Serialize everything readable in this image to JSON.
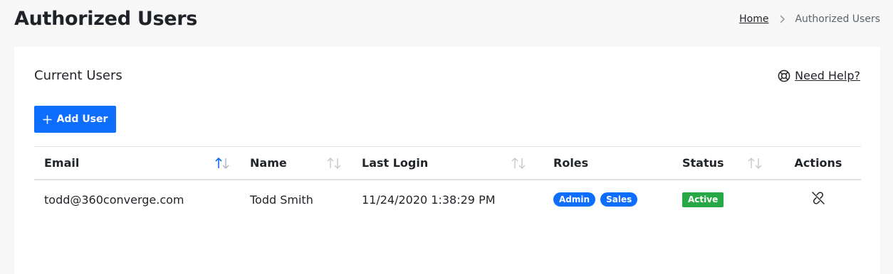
{
  "page": {
    "title": "Authorized Users"
  },
  "breadcrumb": {
    "home": "Home",
    "current": "Authorized Users"
  },
  "card": {
    "title": "Current Users",
    "help_label": "Need Help?",
    "add_button_label": "Add User"
  },
  "table": {
    "columns": {
      "email": "Email",
      "name": "Name",
      "last_login": "Last Login",
      "roles": "Roles",
      "status": "Status",
      "actions": "Actions"
    },
    "sorted_column": "email",
    "sort_direction": "ascending",
    "rows": [
      {
        "email": "todd@360converge.com",
        "name": "Todd Smith",
        "last_login": "11/24/2020 1:38:29 PM",
        "roles": [
          "Admin",
          "Sales"
        ],
        "status": "Active",
        "action_icon": "unlink-icon"
      }
    ]
  },
  "colors": {
    "primary": "#0d6efd",
    "success": "#28a745",
    "background": "#f7f7f8",
    "card": "#ffffff"
  },
  "icons": {
    "help": "lifebuoy-icon",
    "add": "plus-icon",
    "breadcrumb_separator": "chevron-right-icon",
    "sort": "sort-arrows-icon",
    "row_action": "unlink-icon"
  }
}
